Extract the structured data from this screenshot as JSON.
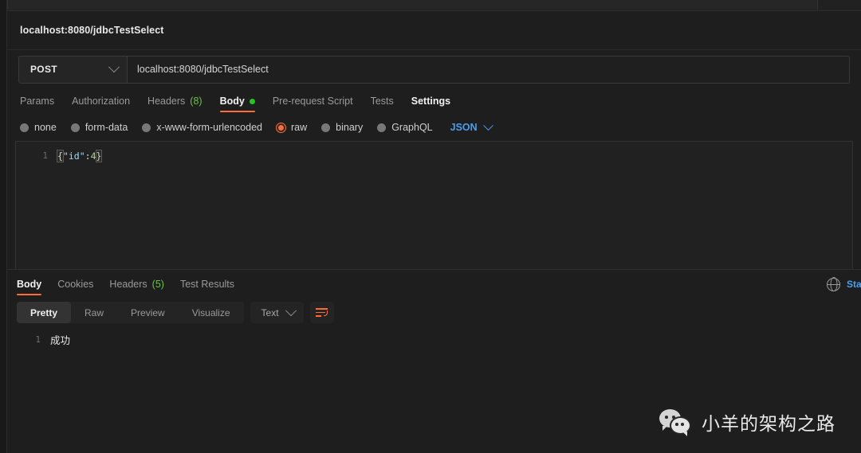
{
  "window": {
    "request_title": "localhost:8080/jdbcTestSelect"
  },
  "url_bar": {
    "method": "POST",
    "url": "localhost:8080/jdbcTestSelect"
  },
  "request_tabs": [
    {
      "label": "Params",
      "active": false
    },
    {
      "label": "Authorization",
      "active": false
    },
    {
      "label": "Headers",
      "count": "(8)",
      "active": false
    },
    {
      "label": "Body",
      "active": true,
      "has_green_dot": true
    },
    {
      "label": "Pre-request Script",
      "active": false
    },
    {
      "label": "Tests",
      "active": false
    },
    {
      "label": "Settings",
      "active": false,
      "strong": true
    }
  ],
  "body_types": [
    {
      "label": "none",
      "selected": false
    },
    {
      "label": "form-data",
      "selected": false
    },
    {
      "label": "x-www-form-urlencoded",
      "selected": false
    },
    {
      "label": "raw",
      "selected": true
    },
    {
      "label": "binary",
      "selected": false
    },
    {
      "label": "GraphQL",
      "selected": false
    }
  ],
  "body_format": {
    "label": "JSON",
    "chevron": "chevron-down-icon"
  },
  "request_body": {
    "line_number": "1",
    "open_brace": "{",
    "key": "\"id\"",
    "colon": ":",
    "value": "4",
    "close_brace": "}",
    "raw": "{\"id\":4}"
  },
  "response": {
    "tabs": [
      {
        "label": "Body",
        "active": true
      },
      {
        "label": "Cookies",
        "active": false
      },
      {
        "label": "Headers",
        "count": "(5)",
        "active": false
      },
      {
        "label": "Test Results",
        "active": false
      }
    ],
    "view_modes": [
      {
        "label": "Pretty",
        "active": true
      },
      {
        "label": "Raw",
        "active": false
      },
      {
        "label": "Preview",
        "active": false
      },
      {
        "label": "Visualize",
        "active": false
      }
    ],
    "format_select": {
      "label": "Text"
    },
    "wrap_button": "word-wrap-icon",
    "status_partial": "Sta",
    "globe_icon": "globe-icon",
    "body": {
      "line_number": "1",
      "text": "成功"
    }
  },
  "watermark": {
    "text": "小羊的架构之路",
    "icon": "wechat-icon"
  },
  "colors": {
    "accent_orange": "#ff6c37",
    "link_blue": "#4a9ef0",
    "success_green": "#6cc04a",
    "dot_green": "#1ec81e",
    "background": "#1e1e1e"
  }
}
